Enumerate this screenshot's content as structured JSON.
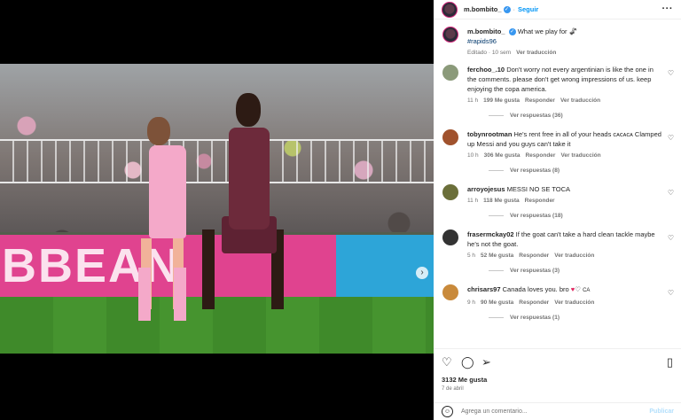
{
  "header": {
    "username": "m.bombito_",
    "follow_label": "Seguir",
    "more_icon": "more-icon"
  },
  "caption": {
    "username": "m.bombito_",
    "text": "What we play for",
    "emoji": "🦨",
    "hashtag": "#rapids96",
    "edited": "Editado · 10 sem",
    "translate": "Ver traducción"
  },
  "comments": [
    {
      "username": "ferchoo_.10",
      "text": "Don't worry not every argentinian is like the one in the comments. please don't get wrong impressions of us. keep enjoying the copa america.",
      "time": "11 h",
      "likes": "199 Me gusta",
      "reply": "Responder",
      "translate": "Ver traducción",
      "replies": "Ver respuestas (36)",
      "avatar_color": "#8b9a7a"
    },
    {
      "username": "tobynrootman",
      "text": "He's rent free in all of your heads ᴄᴀᴄᴀᴄᴀ Clamped up Messi and you guys can't take it",
      "time": "10 h",
      "likes": "306 Me gusta",
      "reply": "Responder",
      "translate": "Ver traducción",
      "replies": "Ver respuestas (8)",
      "avatar_color": "#a0522d"
    },
    {
      "username": "arroyojesus",
      "text": "MESSI NO SE TOCA",
      "time": "11 h",
      "likes": "118 Me gusta",
      "reply": "Responder",
      "translate": "",
      "replies": "Ver respuestas (18)",
      "avatar_color": "#6b6f3a"
    },
    {
      "username": "frasermckay02",
      "text": "If the goat can't take a hard clean tackle maybe he's not the goat.",
      "time": "5 h",
      "likes": "52 Me gusta",
      "reply": "Responder",
      "translate": "Ver traducción",
      "replies": "Ver respuestas (3)",
      "avatar_color": "#333333"
    },
    {
      "username": "chrisars97",
      "text": "Canada loves you. bro",
      "text_suffix": "CA",
      "time": "9 h",
      "likes": "90 Me gusta",
      "reply": "Responder",
      "translate": "Ver traducción",
      "replies": "Ver respuestas (1)",
      "avatar_color": "#c98a3b"
    }
  ],
  "actions": {
    "likes": "3132 Me gusta",
    "date": "7 de abril"
  },
  "add_comment": {
    "placeholder": "Agrega un comentario...",
    "publish": "Publicar"
  },
  "photo": {
    "banner_text": "BBEAN",
    "carousel_total": 4,
    "carousel_active": 1
  }
}
